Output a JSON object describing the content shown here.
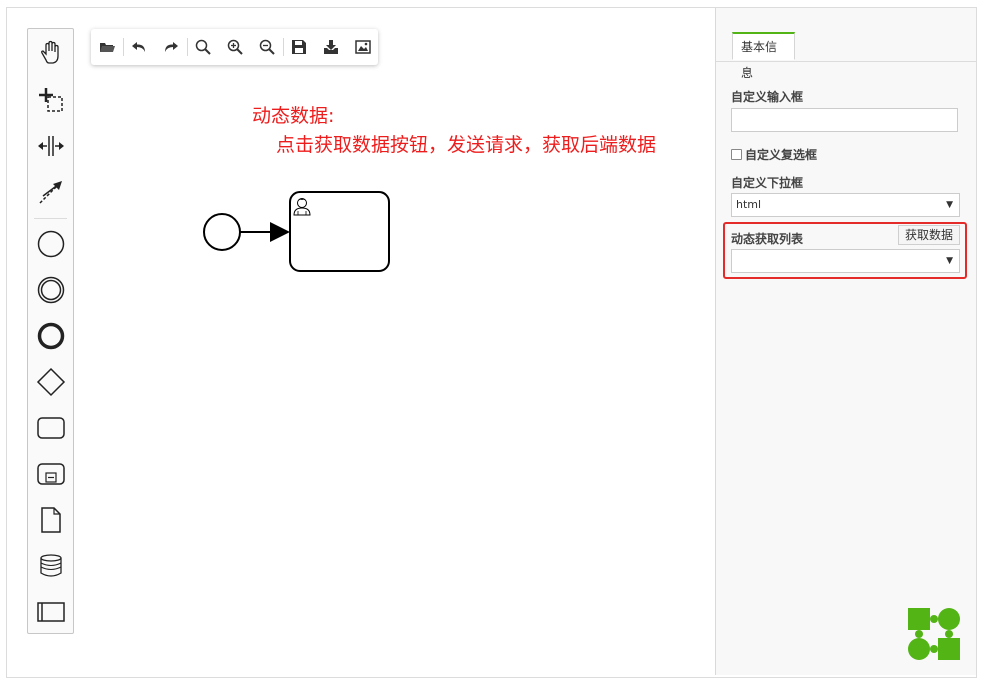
{
  "app": {
    "logo": "bpmn-io-logo",
    "accent_color": "#52b415",
    "note_color": "#ee1d1d",
    "highlight_color": "#e52a2a"
  },
  "palette": {
    "items": [
      {
        "name": "hand-tool-icon"
      },
      {
        "name": "lasso-tool-icon"
      },
      {
        "name": "space-tool-icon"
      },
      {
        "name": "global-connect-tool-icon"
      },
      {
        "name": "start-event-icon"
      },
      {
        "name": "intermediate-event-icon"
      },
      {
        "name": "end-event-icon"
      },
      {
        "name": "gateway-icon"
      },
      {
        "name": "task-icon"
      },
      {
        "name": "subprocess-icon"
      },
      {
        "name": "data-object-icon"
      },
      {
        "name": "data-store-icon"
      },
      {
        "name": "participant-icon"
      }
    ]
  },
  "toolbar": {
    "buttons": [
      "open-folder-icon",
      "undo-icon",
      "redo-icon",
      "zoom-reset-icon",
      "zoom-in-icon",
      "zoom-out-icon",
      "save-icon",
      "download-icon",
      "export-image-icon"
    ]
  },
  "note": {
    "line1": "动态数据:",
    "line2": "点击获取数据按钮，发送请求，获取后端数据"
  },
  "properties": {
    "tab_label": "基本信息",
    "custom_input_label": "自定义输入框",
    "custom_input_value": "",
    "custom_checkbox_label": "自定义复选框",
    "custom_select_label": "自定义下拉框",
    "custom_select_value": "html",
    "dynamic_list_label": "动态获取列表",
    "fetch_button_label": "获取数据",
    "dynamic_select_value": ""
  }
}
